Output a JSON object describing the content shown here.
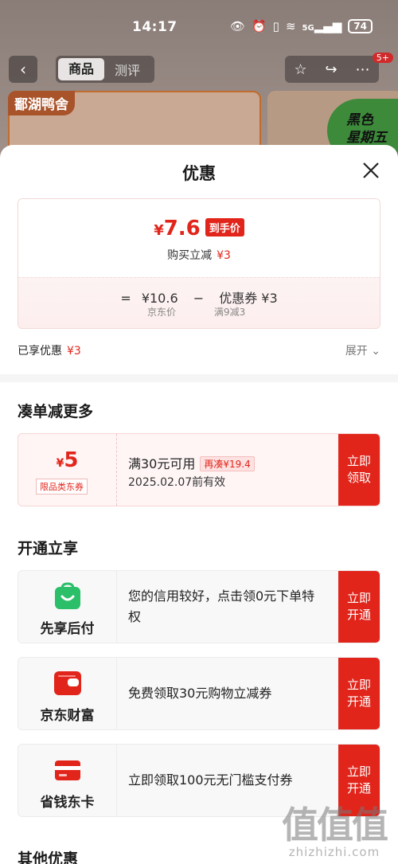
{
  "status_bar": {
    "time": "14:17",
    "network": "5G",
    "battery": "74"
  },
  "background": {
    "tabs": [
      "商品",
      "测评"
    ],
    "badge": "5+",
    "card1_tag": "鄱湖鸭舍",
    "card2_promo": "黑色\n星期五"
  },
  "sheet": {
    "title": "优惠",
    "price": {
      "yen": "¥",
      "value": "7.6",
      "tag": "到手价",
      "sub_label": "购买立减",
      "sub_value": "¥3"
    },
    "calc": {
      "eq": "=",
      "base": "¥10.6",
      "minus": "−",
      "coupon": "优惠券 ¥3",
      "base_label": "京东价",
      "coupon_label": "满9减3"
    },
    "enjoyed_label": "已享优惠",
    "enjoyed_value": "¥3",
    "expand_label": "展开"
  },
  "sections": {
    "more": {
      "title": "凑单减更多"
    },
    "open": {
      "title": "开通立享"
    },
    "other": {
      "title": "其他优惠"
    }
  },
  "coupon": {
    "yen": "¥",
    "amount": "5",
    "category": "限品类东券",
    "condition": "满30元可用",
    "pill": "再凑¥19.4",
    "expiry": "2025.02.07前有效",
    "button": "立即\n领取"
  },
  "services": [
    {
      "name": "先享后付",
      "desc": "您的信用较好，点击领0元下单特权",
      "button": "立即\n开通",
      "color": "#2bbf6a"
    },
    {
      "name": "京东财富",
      "desc": "免费领取30元购物立减券",
      "button": "立即\n开通",
      "color": "#e1251b"
    },
    {
      "name": "省钱东卡",
      "desc": "立即领取100元无门槛支付券",
      "button": "立即\n开通",
      "color": "#e1251b"
    }
  ],
  "watermark": {
    "big": "值值值",
    "small": "zhizhizhi.com"
  }
}
